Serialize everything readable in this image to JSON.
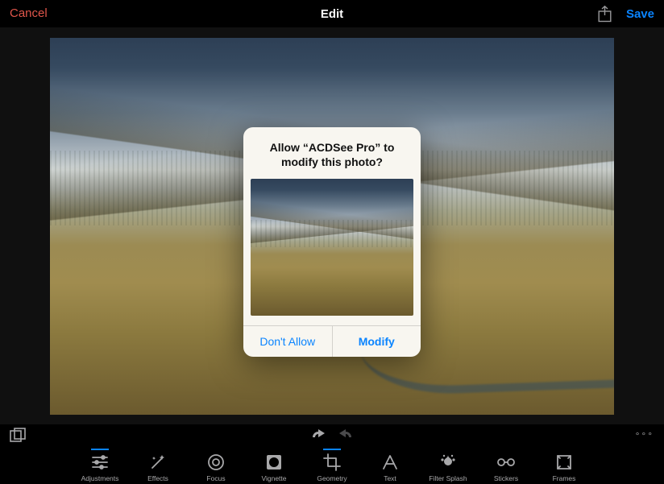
{
  "navbar": {
    "cancel": "Cancel",
    "title": "Edit",
    "save": "Save"
  },
  "dialog": {
    "title": "Allow “ACDSee Pro” to modify this photo?",
    "deny": "Don't Allow",
    "allow": "Modify"
  },
  "util": {
    "more": "•••"
  },
  "tools": [
    {
      "id": "adjustments",
      "label": "Adjustments",
      "icon": "sliders",
      "active": true
    },
    {
      "id": "effects",
      "label": "Effects",
      "icon": "wand",
      "active": false
    },
    {
      "id": "focus",
      "label": "Focus",
      "icon": "target",
      "active": false
    },
    {
      "id": "vignette",
      "label": "Vignette",
      "icon": "vignette",
      "active": false
    },
    {
      "id": "geometry",
      "label": "Geometry",
      "icon": "crop",
      "active": true
    },
    {
      "id": "text",
      "label": "Text",
      "icon": "letter",
      "active": false
    },
    {
      "id": "filter-splash",
      "label": "Filter Splash",
      "icon": "splash",
      "active": false
    },
    {
      "id": "stickers",
      "label": "Stickers",
      "icon": "glasses",
      "active": false
    },
    {
      "id": "frames",
      "label": "Frames",
      "icon": "frame",
      "active": false
    }
  ]
}
